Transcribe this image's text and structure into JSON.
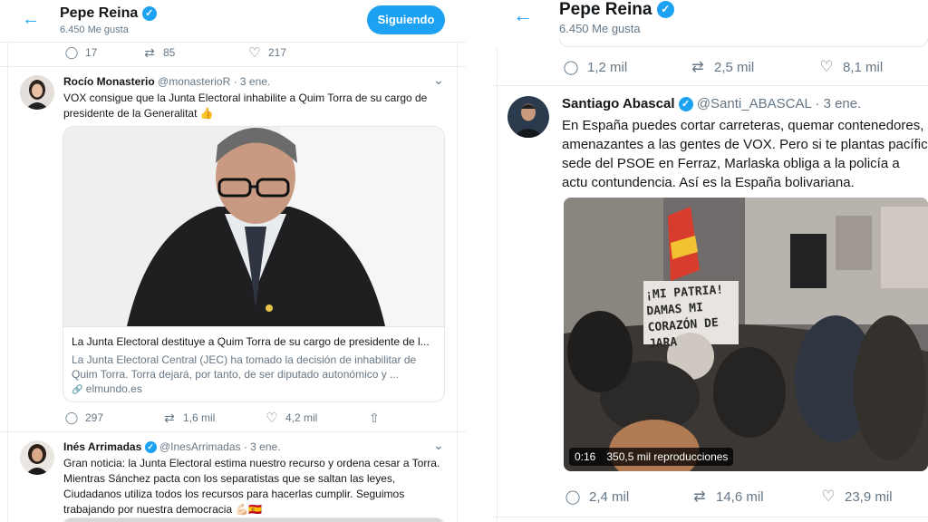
{
  "left": {
    "header": {
      "name": "Pepe Reina",
      "likes": "6.450 Me gusta",
      "follow_button": "Siguiendo",
      "back_icon": "←",
      "verified_icon": "✓"
    },
    "top_actions": {
      "reply": "17",
      "retweet": "85",
      "like": "217"
    },
    "tweet1": {
      "name": "Rocío Monasterio",
      "handle": "@monasterioR",
      "time": "· 3 ene.",
      "text": "VOX consigue que la Junta Electoral inhabilite a Quim Torra de su cargo de presidente de la Generalitat 👍",
      "card": {
        "title": "La Junta Electoral destituye a Quim Torra de su cargo de presidente de l...",
        "description": "La Junta Electoral Central (JEC) ha tomado la decisión de inhabilitar de Quim Torra. Torra dejará, por tanto, de ser diputado autonómico y ...",
        "domain": "elmundo.es",
        "link_icon": "🔗"
      },
      "actions": {
        "reply": "297",
        "retweet": "1,6 mil",
        "like": "4,2 mil"
      }
    },
    "tweet2": {
      "name": "Inés Arrimadas",
      "handle": "@InesArrimadas",
      "time": "· 3 ene.",
      "text": "Gran noticia: la Junta Electoral estima nuestro recurso y ordena cesar a Torra. Mientras Sánchez pacta con los separatistas que se saltan las leyes, Ciudadanos utiliza todos los recursos para hacerlas cumplir. Seguimos trabajando por nuestra democracia 💪🏻🇪🇸"
    }
  },
  "right": {
    "header": {
      "name": "Pepe Reina",
      "likes": "6.450 Me gusta",
      "back_icon": "←",
      "verified_icon": "✓"
    },
    "top_actions": {
      "reply": "1,2 mil",
      "retweet": "2,5 mil",
      "like": "8,1 mil"
    },
    "tweet": {
      "name": "Santiago Abascal",
      "handle": "@Santi_ABASCAL",
      "time": "· 3 ene.",
      "text": "En España puedes cortar carreteras, quemar contenedores, amenazantes a las gentes de VOX. Pero si te plantas pacífic sede del PSOE en Ferraz, Marlaska obliga a la policía a actu contundencia. Así es la España bolivariana.",
      "video": {
        "duration": "0:16",
        "views": "350,5 mil reproducciones",
        "sign_text": "¡MI PATRIA! DAMAS MI CORAZÓN DE JARA"
      },
      "actions": {
        "reply": "2,4 mil",
        "retweet": "14,6 mil",
        "like": "23,9 mil"
      }
    }
  },
  "icons": {
    "reply": "◯",
    "retweet": "⇄",
    "like": "♡",
    "share": "⇧",
    "caret": "⌄"
  },
  "colors": {
    "accent": "#1da1f2",
    "text": "#14171a",
    "muted": "#657786",
    "border": "#e6ecf0"
  }
}
